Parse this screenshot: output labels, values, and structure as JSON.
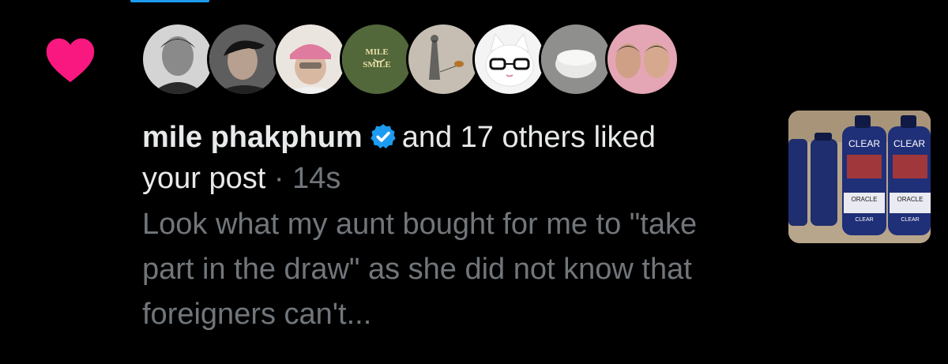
{
  "notification": {
    "type": "like",
    "user_name": "mile phakphum",
    "action_text": "and 17 others liked",
    "action_text_cont": "your post",
    "separator": "·",
    "time": "14s",
    "post_preview": "Look what my aunt bought for me to \"take part in the draw\" as she did not know that foreigners can't...",
    "icon": "heart-icon",
    "verified_icon": "verified-badge-icon"
  },
  "avatars": [
    {
      "name": "avatar-1",
      "bg": "#d8d8d8"
    },
    {
      "name": "avatar-2",
      "bg": "#6a6a6a"
    },
    {
      "name": "avatar-3",
      "bg": "#e7e2dd"
    },
    {
      "name": "avatar-4",
      "bg": "#52683a",
      "text_line1": "MILE",
      "text_line2": "SMILE"
    },
    {
      "name": "avatar-5",
      "bg": "#c9c2b8"
    },
    {
      "name": "avatar-6",
      "bg": "#f2f2f2"
    },
    {
      "name": "avatar-7",
      "bg": "#9a9a98"
    },
    {
      "name": "avatar-8",
      "bg": "#d6a49a"
    }
  ],
  "thumbnail": {
    "bottle_brand": "CLEAR",
    "sponsor": "ORACLE"
  },
  "colors": {
    "background": "#000000",
    "heart": "#f91880",
    "primary_text": "#e7e9ea",
    "secondary_text": "#71767b",
    "verified": "#1d9bf0"
  }
}
